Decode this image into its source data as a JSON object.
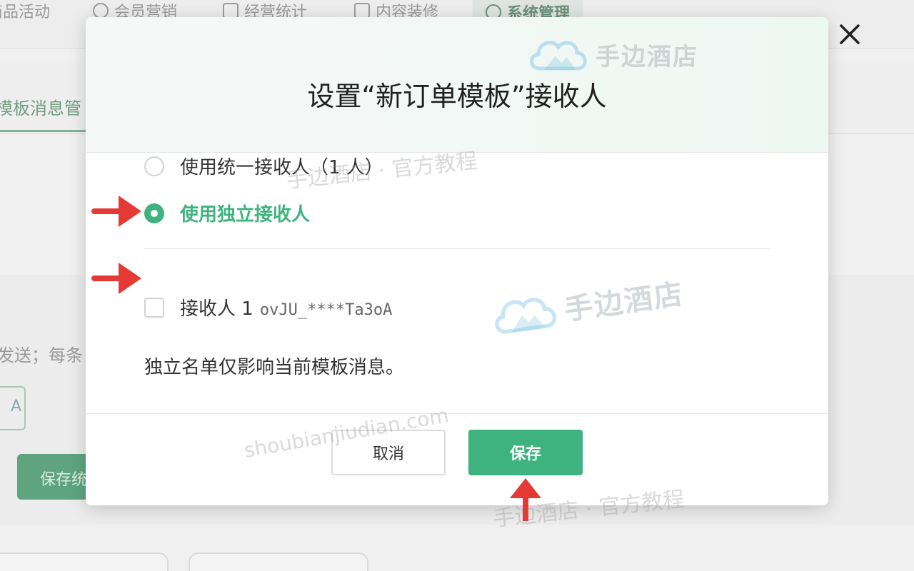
{
  "background": {
    "nav": [
      "商品活动",
      "会员营销",
      "经营统计",
      "内容装修",
      "系统管理"
    ],
    "subtab": "模板消息管",
    "text": "发送；每条",
    "input": "A",
    "button": "保存统"
  },
  "modal": {
    "title": "设置“新订单模板”接收人",
    "options": [
      {
        "label": "使用统一接收人（1 人）",
        "checked": false
      },
      {
        "label": "使用独立接收人",
        "checked": true
      }
    ],
    "recipient": {
      "name": "接收人 1",
      "id": "ovJU_****Ta3oA",
      "checked": false
    },
    "note": "独立名单仅影响当前模板消息。",
    "cancel_label": "取消",
    "save_label": "保存"
  },
  "watermarks": {
    "logo_text": "手边酒店",
    "tutorial": "手边酒店 · 官方教程",
    "url": "shoubianjiudian.com"
  },
  "colors": {
    "accent": "#3fb37f",
    "annotation_arrow": "#e53935"
  }
}
